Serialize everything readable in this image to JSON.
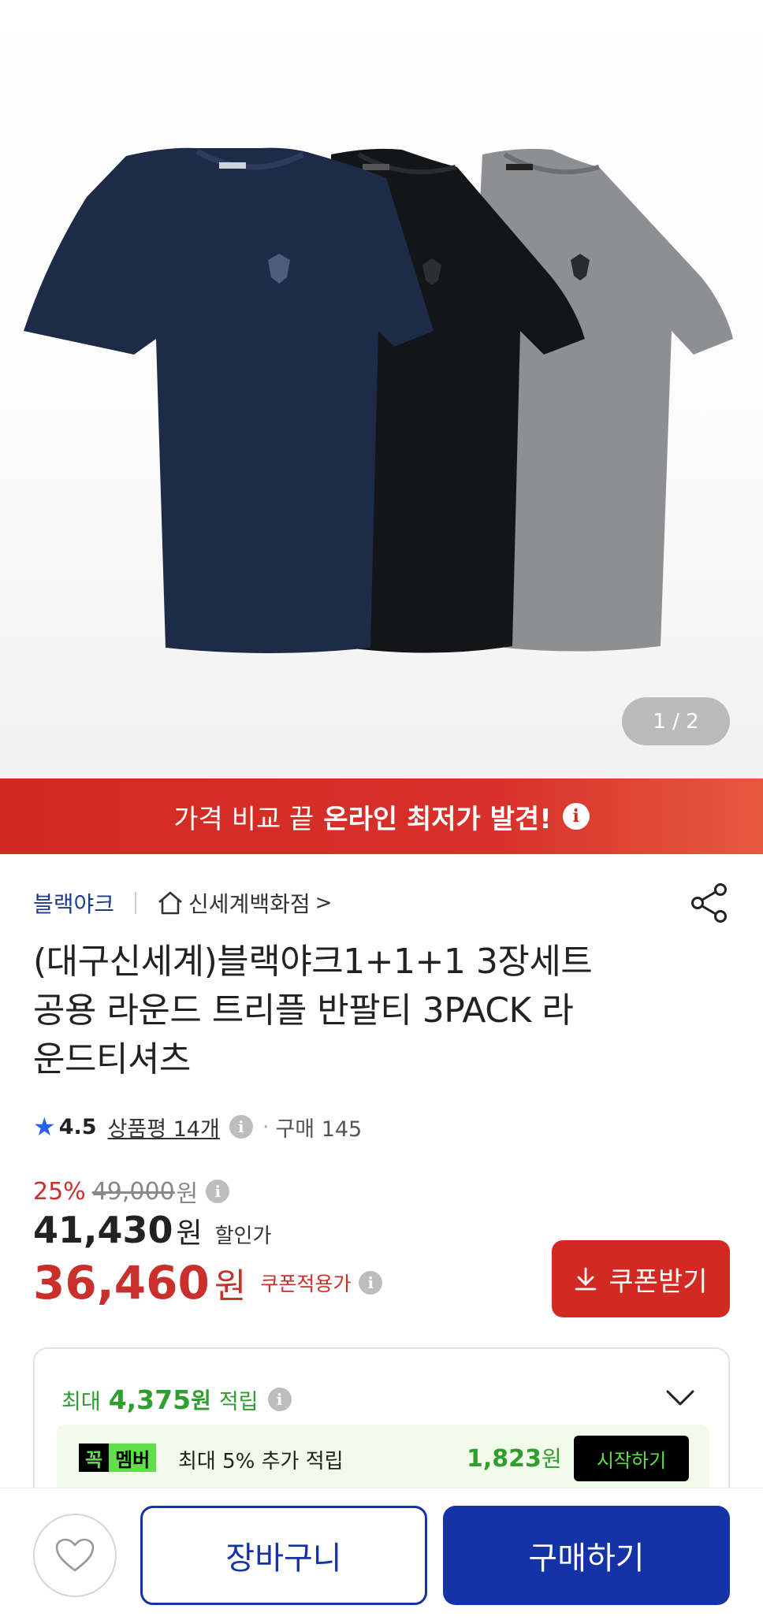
{
  "gallery": {
    "page_indicator": "1 / 2"
  },
  "banner": {
    "text_regular": "가격 비교 끝",
    "text_bold": "온라인 최저가 발견!",
    "info_glyph": "i"
  },
  "seller": {
    "brand": "블랙야크",
    "store": "신세계백화점",
    "store_chevron": ">"
  },
  "product": {
    "title_lines": [
      "(대구신세계)블랙야크1+1+1 3장세트",
      "공용 라운드 트리플 반팔티 3PACK 라",
      "운드티셔츠"
    ]
  },
  "rating": {
    "score": "4.5",
    "reviews": "상품평 14개",
    "purchase": "구매 145",
    "star": "★",
    "info_glyph": "i",
    "separator": "·"
  },
  "price": {
    "discount_pct": "25%",
    "original": "49,000",
    "original_unit": "원",
    "sale": "41,430",
    "sale_unit": "원",
    "sale_label": "할인가",
    "coupon_price": "36,460",
    "coupon_unit": "원",
    "coupon_label": "쿠폰적용가",
    "coupon_button": "쿠폰받기",
    "info_glyph": "i"
  },
  "rewards": {
    "prefix": "최대",
    "amount": "4,375",
    "unit": "원",
    "suffix": "적립",
    "info_glyph": "i",
    "member_badge_left": "꼭",
    "member_badge_right": "멤버",
    "member_text": "최대 5% 추가 적립",
    "member_amount": "1,823",
    "member_unit": "원",
    "start_button": "시작하기"
  },
  "bottom": {
    "cart": "장바구니",
    "buy": "구매하기"
  },
  "colors": {
    "accent_red": "#d12a22",
    "accent_navy": "#1433a6",
    "reward_green": "#2e9e2e",
    "member_green": "#5fe04a",
    "brand_link": "#1f3a8a"
  },
  "icons": [
    "star-icon",
    "info-icon",
    "home-icon",
    "share-icon",
    "download-icon",
    "chevron-down-icon",
    "heart-icon"
  ]
}
